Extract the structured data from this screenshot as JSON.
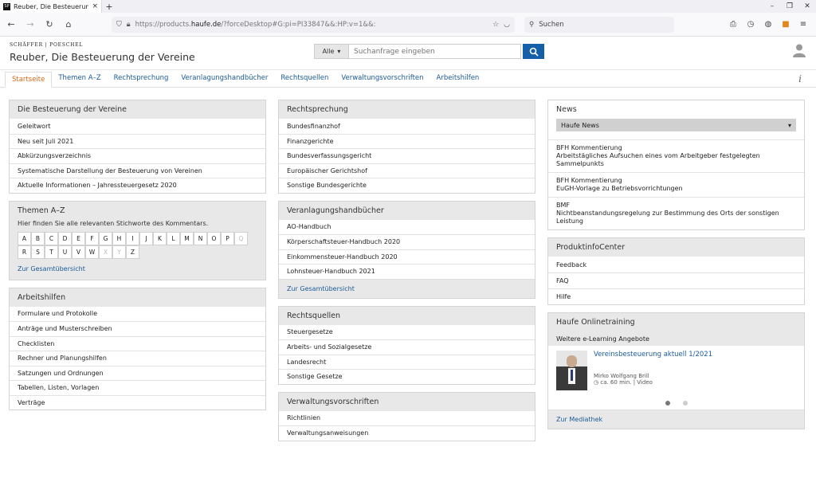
{
  "browser": {
    "tab_title": "Reuber, Die Besteuerung der Ve",
    "favicon_text": "SP",
    "url_prefix": "https://products.",
    "url_domain": "haufe.de",
    "url_rest": "/?forceDesktop#G:pi=PI33847&&:HP:v=1&&:",
    "search_placeholder": "Suchen"
  },
  "header": {
    "publisher": "SCHÄFFER | POESCHEL",
    "title": "Reuber, Die Besteuerung der Vereine",
    "search_scope": "Alle",
    "search_placeholder": "Suchanfrage eingeben"
  },
  "nav": {
    "tabs": [
      {
        "label": "Startseite"
      },
      {
        "label": "Themen A–Z"
      },
      {
        "label": "Rechtsprechung"
      },
      {
        "label": "Veranlagungshandbücher"
      },
      {
        "label": "Rechtsquellen"
      },
      {
        "label": "Verwaltungsvorschriften"
      },
      {
        "label": "Arbeitshilfen"
      }
    ],
    "info": "i"
  },
  "col1": {
    "besteuerung": {
      "title": "Die Besteuerung der Vereine",
      "items": [
        "Geleitwort",
        "Neu seit Juli 2021",
        "Abkürzungsverzeichnis",
        "Systematische Darstellung der Besteuerung von Vereinen",
        "Aktuelle Informationen – Jahressteuergesetz 2020"
      ]
    },
    "themen": {
      "title": "Themen A–Z",
      "note": "Hier finden Sie alle relevanten Stichworte des Kommentars.",
      "letters": [
        "A",
        "B",
        "C",
        "D",
        "E",
        "F",
        "G",
        "H",
        "I",
        "J",
        "K",
        "L",
        "M",
        "N",
        "O",
        "P",
        "Q",
        "R",
        "S",
        "T",
        "U",
        "V",
        "W",
        "X",
        "Y",
        "Z"
      ],
      "disabled": [
        "Q",
        "X",
        "Y"
      ],
      "link": "Zur Gesamtübersicht"
    },
    "arbeitshilfen": {
      "title": "Arbeitshilfen",
      "items": [
        "Formulare und Protokolle",
        "Anträge und Musterschreiben",
        "Checklisten",
        "Rechner und Planungshilfen",
        "Satzungen und Ordnungen",
        "Tabellen, Listen, Vorlagen",
        "Verträge"
      ]
    }
  },
  "col2": {
    "rechtsprechung": {
      "title": "Rechtsprechung",
      "items": [
        "Bundesfinanzhof",
        "Finanzgerichte",
        "Bundesverfassungsgericht",
        "Europäischer Gerichtshof",
        "Sonstige Bundesgerichte"
      ]
    },
    "veranlagung": {
      "title": "Veranlagungshandbücher",
      "items": [
        "AO-Handbuch",
        "Körperschaftsteuer-Handbuch 2020",
        "Einkommensteuer-Handbuch 2020",
        "Lohnsteuer-Handbuch 2021"
      ],
      "link": "Zur Gesamtübersicht"
    },
    "rechtsquellen": {
      "title": "Rechtsquellen",
      "items": [
        "Steuergesetze",
        "Arbeits- und Sozialgesetze",
        "Landesrecht",
        "Sonstige Gesetze"
      ]
    },
    "verwaltung": {
      "title": "Verwaltungsvorschriften",
      "items": [
        "Richtlinien",
        "Verwaltungsanweisungen"
      ]
    }
  },
  "col3": {
    "news": {
      "title": "News",
      "select": "Haufe News",
      "items": [
        {
          "source": "BFH Kommentierung",
          "text": "Arbeitstägliches Aufsuchen eines vom Arbeitgeber festgelegten Sammelpunkts"
        },
        {
          "source": "BFH Kommentierung",
          "text": "EuGH-Vorlage zu Betriebsvorrichtungen"
        },
        {
          "source": "BMF",
          "text": "Nichtbeanstandungsregelung zur Bestimmung des Orts der sonstigen Leistung"
        }
      ]
    },
    "produktinfo": {
      "title": "ProduktinfoCenter",
      "items": [
        "Feedback",
        "FAQ",
        "Hilfe"
      ]
    },
    "training": {
      "title": "Haufe Onlinetraining",
      "subtitle": "Weitere e-Learning Angebote",
      "course_title": "Vereinsbesteuerung aktuell 1/2021",
      "author": "Mirko Wolfgang Brill",
      "meta": "ca. 60 min. | Video",
      "link": "Zur Mediathek"
    }
  }
}
